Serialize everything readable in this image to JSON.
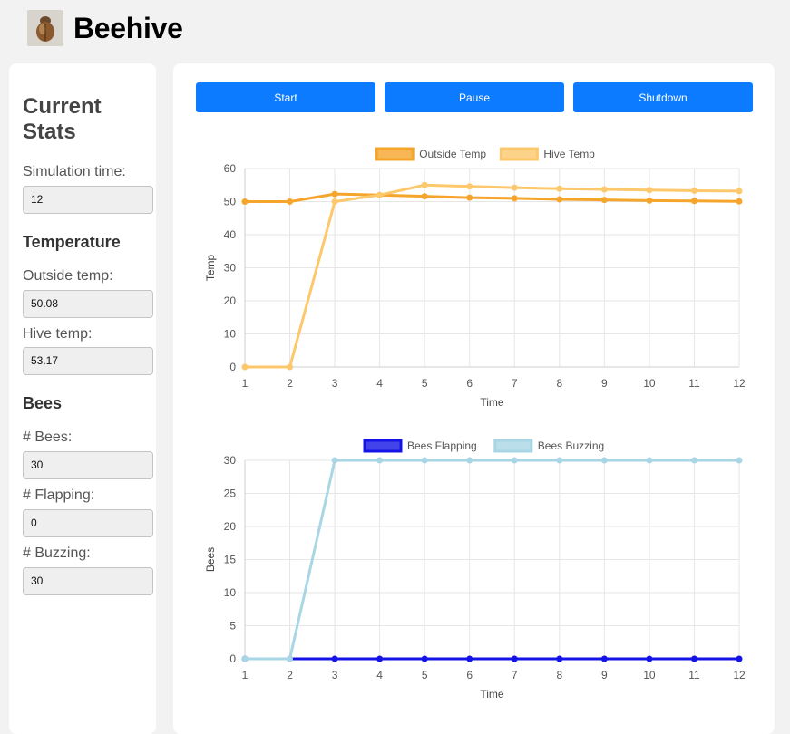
{
  "app": {
    "title": "Beehive",
    "logo_icon": "beetle-icon"
  },
  "sidebar": {
    "heading": "Current Stats",
    "sim_time_label": "Simulation time:",
    "sim_time_value": "12",
    "temperature_heading": "Temperature",
    "outside_temp_label": "Outside temp:",
    "outside_temp_value": "50.08",
    "hive_temp_label": "Hive temp:",
    "hive_temp_value": "53.17",
    "bees_heading": "Bees",
    "bees_label": "# Bees:",
    "bees_value": "30",
    "flapping_label": "# Flapping:",
    "flapping_value": "0",
    "buzzing_label": "# Buzzing:",
    "buzzing_value": "30"
  },
  "controls": {
    "start": "Start",
    "pause": "Pause",
    "shutdown": "Shutdown",
    "accent": "#0d7bff"
  },
  "chart_data": [
    {
      "type": "line",
      "x": [
        1,
        2,
        3,
        4,
        5,
        6,
        7,
        8,
        9,
        10,
        11,
        12
      ],
      "xlabel": "Time",
      "ylabel": "Temp",
      "ylim": [
        0,
        60
      ],
      "yticks": [
        0,
        10,
        20,
        30,
        40,
        50,
        60
      ],
      "grid": true,
      "legend": "top",
      "series": [
        {
          "name": "Outside Temp",
          "color": "#f5a52c",
          "values": [
            50,
            50,
            52.3,
            52,
            51.6,
            51.2,
            51,
            50.7,
            50.5,
            50.3,
            50.2,
            50.08
          ]
        },
        {
          "name": "Hive Temp",
          "color": "#fcc86b",
          "values": [
            0,
            0,
            50,
            52,
            55,
            54.6,
            54.2,
            53.9,
            53.7,
            53.5,
            53.3,
            53.17
          ]
        }
      ]
    },
    {
      "type": "line",
      "x": [
        1,
        2,
        3,
        4,
        5,
        6,
        7,
        8,
        9,
        10,
        11,
        12
      ],
      "xlabel": "Time",
      "ylabel": "Bees",
      "ylim": [
        0,
        30
      ],
      "yticks": [
        0,
        5,
        10,
        15,
        20,
        25,
        30
      ],
      "grid": true,
      "legend": "top",
      "series": [
        {
          "name": "Bees Flapping",
          "color": "#1414e6",
          "values": [
            0,
            0,
            0,
            0,
            0,
            0,
            0,
            0,
            0,
            0,
            0,
            0
          ]
        },
        {
          "name": "Bees Buzzing",
          "color": "#a9d6e5",
          "values": [
            0,
            0,
            30,
            30,
            30,
            30,
            30,
            30,
            30,
            30,
            30,
            30
          ]
        }
      ]
    }
  ]
}
